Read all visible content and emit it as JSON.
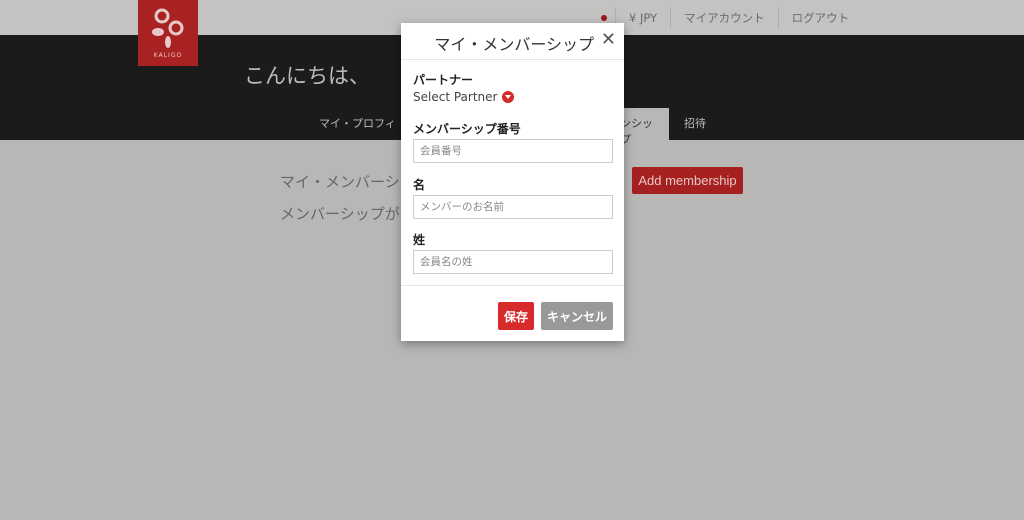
{
  "header": {
    "brand": "KALIGO",
    "currency": "¥ JPY",
    "my_account": "マイアカウント",
    "logout": "ログアウト"
  },
  "hero": {
    "greeting": "こんにちは、"
  },
  "nav": {
    "profile_fragment": "マイ・プロフィ",
    "membership_fragment": "ンシップ",
    "invite": "招待"
  },
  "main": {
    "heading_fragment": "マイ・メンバーシ",
    "empty_fragment": "メンバーシップが",
    "add_button": "Add membership"
  },
  "modal": {
    "title": "マイ・メンバーシップ",
    "partner_label": "パートナー",
    "partner_select": "Select Partner",
    "number_label": "メンバーシップ番号",
    "number_placeholder": "会員番号",
    "first_label": "名",
    "first_placeholder": "メンバーのお名前",
    "last_label": "姓",
    "last_placeholder": "会員名の姓",
    "save": "保存",
    "cancel": "キャンセル"
  },
  "colors": {
    "brand": "#a82222",
    "primary_button": "#d72b2b",
    "secondary_button": "#999999"
  }
}
